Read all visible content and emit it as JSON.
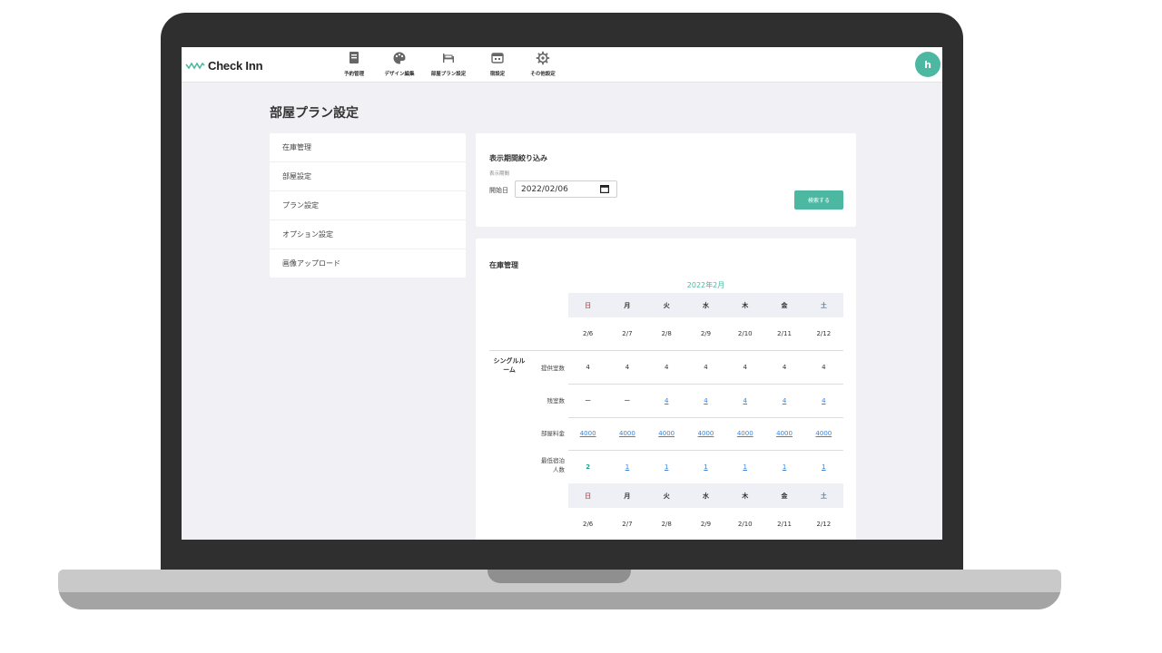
{
  "app": {
    "logo_text": "Check Inn",
    "avatar_initial": "h",
    "accent_color": "#4cb8a2"
  },
  "nav": [
    {
      "label": "予約管理",
      "icon": "notebook-icon"
    },
    {
      "label": "デザイン編集",
      "icon": "palette-icon"
    },
    {
      "label": "部屋プラン設定",
      "icon": "bed-icon"
    },
    {
      "label": "宿設定",
      "icon": "inn-icon"
    },
    {
      "label": "その他設定",
      "icon": "gear-icon"
    }
  ],
  "page": {
    "title": "部屋プラン設定"
  },
  "sidebar": {
    "items": [
      {
        "label": "在庫管理"
      },
      {
        "label": "部屋設定"
      },
      {
        "label": "プラン設定"
      },
      {
        "label": "オプション設定"
      },
      {
        "label": "画像アップロード"
      }
    ]
  },
  "filter": {
    "title": "表示期間絞り込み",
    "subtitle": "表示期間",
    "start_label": "開始日",
    "start_value": "2022/02/06",
    "search_button": "検索する"
  },
  "inventory": {
    "title": "在庫管理",
    "month": "2022年2月",
    "weekdays": [
      "日",
      "月",
      "火",
      "水",
      "木",
      "金",
      "土"
    ],
    "dates": [
      "2/6",
      "2/7",
      "2/8",
      "2/9",
      "2/10",
      "2/11",
      "2/12"
    ],
    "room_name": "シングルルーム",
    "room_name_lines": [
      "シングルル",
      "ーム"
    ],
    "row_labels": {
      "offered": "提供室数",
      "remaining": "残室数",
      "price": "部屋料金",
      "min_stay_line1": "最低宿泊",
      "min_stay_line2": "人数"
    },
    "offered": [
      "4",
      "4",
      "4",
      "4",
      "4",
      "4",
      "4"
    ],
    "remaining": [
      "ー",
      "ー",
      "4",
      "4",
      "4",
      "4",
      "4"
    ],
    "price": [
      "4000",
      "4000",
      "4000",
      "4000",
      "4000",
      "4000",
      "4000"
    ],
    "min_stay": [
      "2",
      "1",
      "1",
      "1",
      "1",
      "1",
      "1"
    ]
  }
}
